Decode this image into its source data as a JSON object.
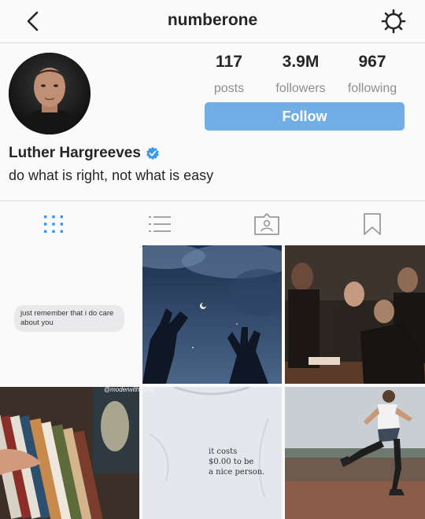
{
  "header": {
    "username": "numberone"
  },
  "profile": {
    "display_name": "Luther Hargreeves",
    "bio": "do what is right, not what is easy",
    "verified": true
  },
  "stats": [
    {
      "value": "117",
      "label": "posts"
    },
    {
      "value": "3.9M",
      "label": "followers"
    },
    {
      "value": "967",
      "label": "following"
    }
  ],
  "actions": {
    "follow_label": "Follow"
  },
  "tabs": [
    "grid-icon",
    "list-icon",
    "tagged-icon",
    "bookmark-icon"
  ],
  "posts": {
    "text_message": "just remember that i do care about you",
    "shirt_text_lines": [
      "it costs",
      "$0.00 to be",
      "a nice person."
    ],
    "watermark": "@moderwithlights"
  },
  "colors": {
    "accent": "#72aee6",
    "verified": "#3897f0",
    "divider": "#dbdbdb"
  }
}
